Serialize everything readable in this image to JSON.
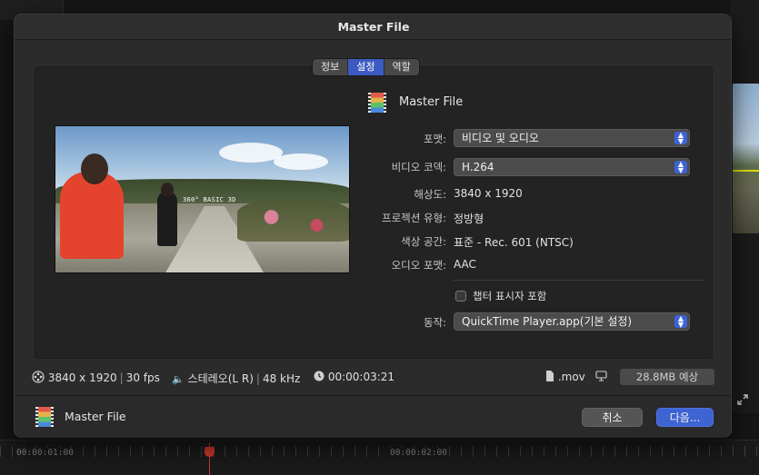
{
  "dialog": {
    "title": "Master File",
    "tabs": [
      {
        "label": "정보",
        "active": false
      },
      {
        "label": "설정",
        "active": true
      },
      {
        "label": "역할",
        "active": false
      }
    ],
    "file_name": "Master File",
    "preview_caption": "360° BASIC 3D",
    "settings": {
      "format_label": "포맷:",
      "format_value": "비디오 및 오디오",
      "codec_label": "비디오 코덱:",
      "codec_value": "H.264",
      "resolution_label": "해상도:",
      "resolution_value": "3840 x 1920",
      "projection_label": "프로젝션 유형:",
      "projection_value": "정방형",
      "colorspace_label": "색상 공간:",
      "colorspace_value": "표준 - Rec. 601 (NTSC)",
      "audioformat_label": "오디오 포맷:",
      "audioformat_value": "AAC",
      "chapter_label": "챕터 표시자 포함",
      "chapter_checked": false,
      "action_label": "동작:",
      "action_value": "QuickTime Player.app(기본 설정)"
    },
    "status": {
      "resolution": "3840 x 1920",
      "fps": "30 fps",
      "audio": "스테레오(L R)",
      "sample_rate": "48 kHz",
      "duration": "00:00:03:21",
      "extension": ".mov",
      "size": "28.8MB 예상"
    },
    "footer": {
      "file_name": "Master File",
      "cancel_label": "취소",
      "next_label": "다음..."
    }
  },
  "timeline": {
    "label_1": "00:00:01:00",
    "label_2": "00:00:02:00"
  },
  "colors": {
    "accent": "#3e63d3",
    "playhead": "#d33a2c",
    "dialog_bg": "#2b2b2b"
  }
}
